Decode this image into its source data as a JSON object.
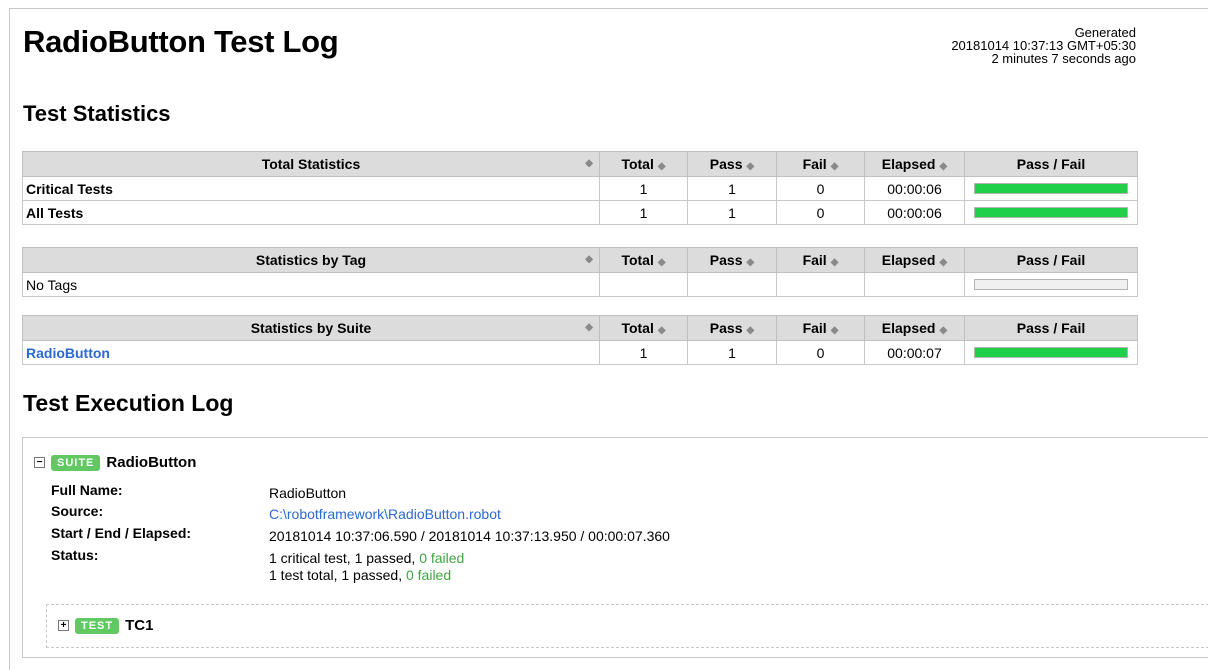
{
  "title": "RadioButton Test Log",
  "generated": {
    "label": "Generated",
    "timestamp": "20181014 10:37:13 GMT+05:30",
    "ago": "2 minutes 7 seconds ago"
  },
  "stats_heading": "Test Statistics",
  "columns": {
    "total": "Total",
    "pass": "Pass",
    "fail": "Fail",
    "elapsed": "Elapsed",
    "passfail": "Pass / Fail"
  },
  "total_stats": {
    "header": "Total Statistics",
    "rows": [
      {
        "name": "Critical Tests",
        "total": "1",
        "pass": "1",
        "fail": "0",
        "elapsed": "00:00:06",
        "pass_fraction": 1.0
      },
      {
        "name": "All Tests",
        "total": "1",
        "pass": "1",
        "fail": "0",
        "elapsed": "00:00:06",
        "pass_fraction": 1.0
      }
    ]
  },
  "tag_stats": {
    "header": "Statistics by Tag",
    "rows": [
      {
        "name": "No Tags",
        "total": "",
        "pass": "",
        "fail": "",
        "elapsed": "",
        "pass_fraction": 0
      }
    ]
  },
  "suite_stats": {
    "header": "Statistics by Suite",
    "rows": [
      {
        "name": "RadioButton",
        "total": "1",
        "pass": "1",
        "fail": "0",
        "elapsed": "00:00:07",
        "pass_fraction": 1.0
      }
    ]
  },
  "exec_heading": "Test Execution Log",
  "suite": {
    "toggle": "−",
    "badge": "SUITE",
    "name": "RadioButton",
    "full_name_label": "Full Name:",
    "full_name": "RadioButton",
    "source_label": "Source:",
    "source": "C:\\robotframework\\RadioButton.robot",
    "times_label": "Start / End / Elapsed:",
    "times": "20181014 10:37:06.590 / 20181014 10:37:13.950 / 00:00:07.360",
    "status_label": "Status:",
    "status_line1_prefix": "1 critical test, 1 passed, ",
    "status_line1_failed": "0 failed",
    "status_line2_prefix": "1 test total, 1 passed, ",
    "status_line2_failed": "0 failed"
  },
  "test": {
    "toggle": "+",
    "badge": "TEST",
    "name": "TC1"
  },
  "colors": {
    "pass_bar": "#1fd04a",
    "link": "#2a6ad4",
    "badge": "#61c864"
  }
}
